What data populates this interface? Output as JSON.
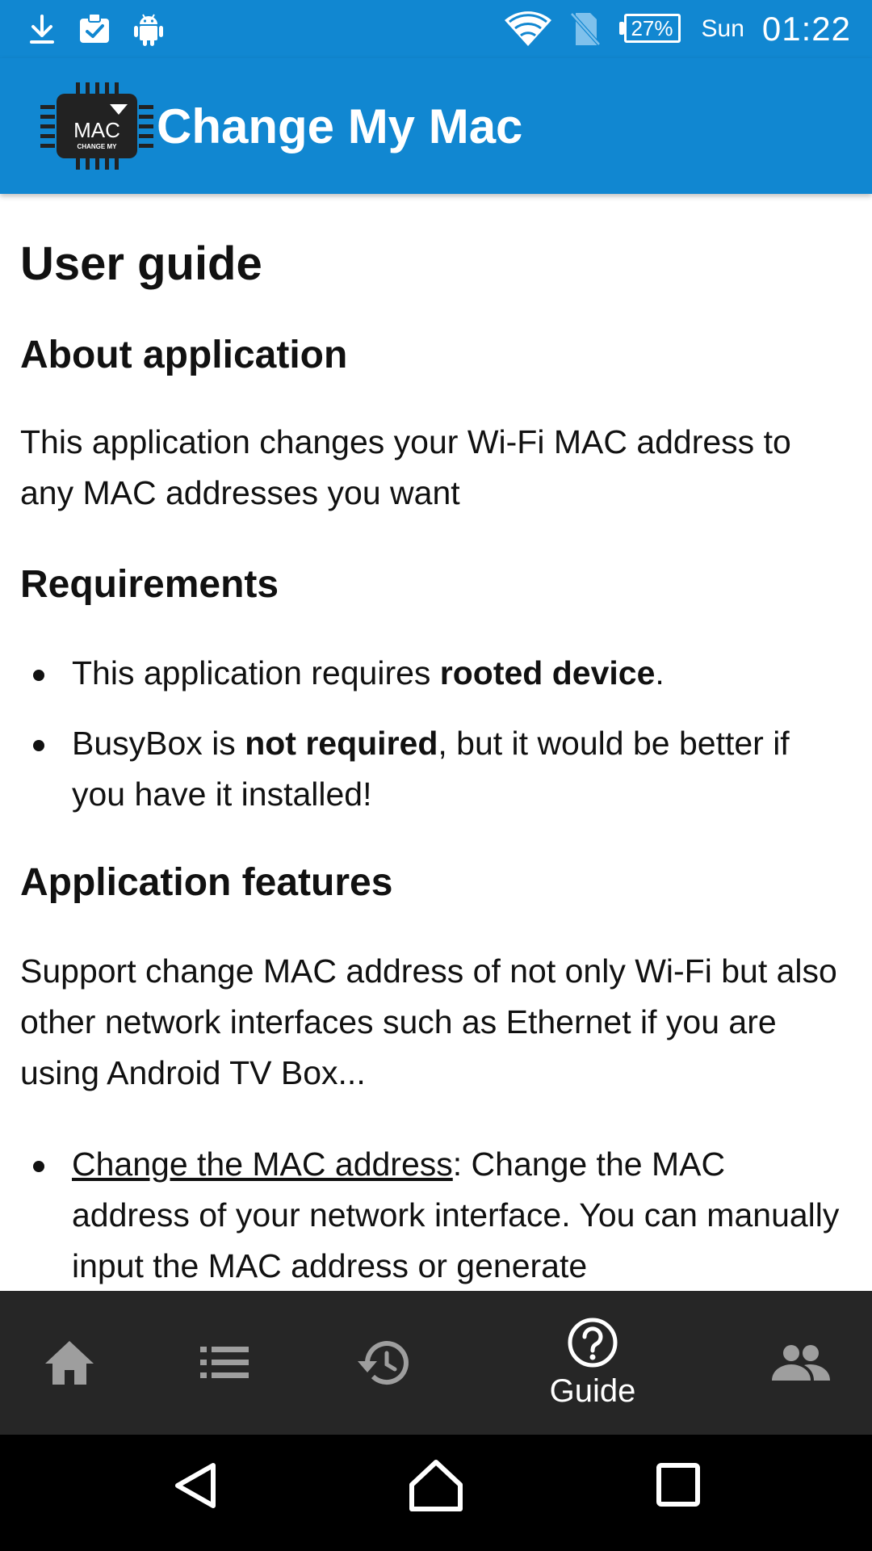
{
  "status_bar": {
    "battery_percent": "27%",
    "battery_level": 0.27,
    "day": "Sun",
    "time": "01:22",
    "icons": [
      "download-icon",
      "clipboard-check-icon",
      "android-icon",
      "wifi-icon",
      "no-sim-icon",
      "battery-icon"
    ]
  },
  "app_bar": {
    "title": "Change My Mac",
    "logo_text": "MAC",
    "logo_subtext": "CHANGE MY",
    "color": "#1187d1"
  },
  "content": {
    "title": "User guide",
    "about": {
      "heading": "About application",
      "text": "This application changes your Wi-Fi MAC address to any MAC addresses you want"
    },
    "requirements": {
      "heading": "Requirements",
      "items": [
        {
          "pre": "This application requires ",
          "bold": "rooted device",
          "post": "."
        },
        {
          "pre": "BusyBox is ",
          "bold": "not required",
          "post": ", but it would be better if you have it installed!"
        }
      ]
    },
    "features": {
      "heading": "Application features",
      "text": "Support change MAC address of not only Wi-Fi but also other network interfaces such as Ethernet if you are using Android TV Box...",
      "items": [
        {
          "link": "Change the MAC address",
          "text": ": Change the MAC address of your network interface. You can manually input the MAC address or generate"
        }
      ]
    }
  },
  "bottom_tabs": {
    "active_label": "Guide",
    "tabs": [
      "home-icon",
      "list-icon",
      "history-icon",
      "help-circle-icon",
      "people-icon"
    ]
  },
  "nav_bar": {
    "buttons": [
      "back-icon",
      "home-outline-icon",
      "recents-icon"
    ]
  }
}
